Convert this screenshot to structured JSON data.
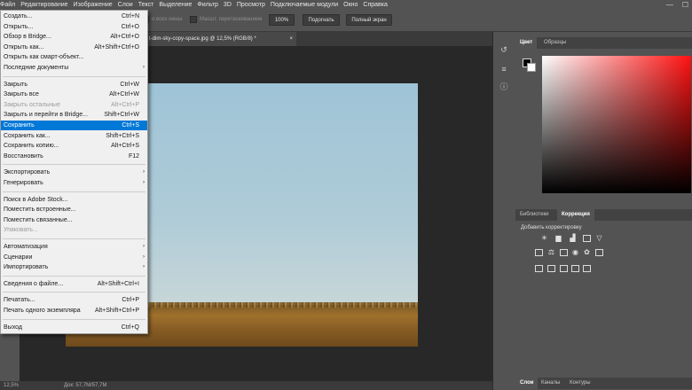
{
  "menubar": {
    "items": [
      "Файл",
      "Редактирование",
      "Изображение",
      "Слои",
      "Текст",
      "Выделение",
      "Фильтр",
      "3D",
      "Просмотр",
      "Подключаемые модули",
      "Окно",
      "Справка"
    ],
    "window_controls": [
      "—",
      "☐"
    ]
  },
  "options_bar": {
    "all_windows_label": "о всех окнах",
    "scrubby_label": "Масшт. перетаскиванием",
    "zoom_btn": "100%",
    "fit_btn": "Подогнать",
    "fullscreen_btn": "Полный экран"
  },
  "document": {
    "tab_title": "t-dim-sky-copy-space.jpg @ 12,5% (RGB/8) *",
    "close": "×"
  },
  "status": {
    "zoom": "12,5%",
    "doc": "Док: 57,7M/57,7M"
  },
  "file_menu": {
    "items": [
      {
        "label": "Создать...",
        "shortcut": "Ctrl+N",
        "state": "normal"
      },
      {
        "label": "Открыть...",
        "shortcut": "Ctrl+O",
        "state": "normal"
      },
      {
        "label": "Обзор в Bridge...",
        "shortcut": "Alt+Ctrl+O",
        "state": "normal"
      },
      {
        "label": "Открыть как...",
        "shortcut": "Alt+Shift+Ctrl+O",
        "state": "normal"
      },
      {
        "label": "Открыть как смарт-объект...",
        "shortcut": "",
        "state": "normal"
      },
      {
        "label": "Последние документы",
        "shortcut": "",
        "state": "submenu"
      },
      {
        "sep": true
      },
      {
        "label": "Закрыть",
        "shortcut": "Ctrl+W",
        "state": "normal"
      },
      {
        "label": "Закрыть все",
        "shortcut": "Alt+Ctrl+W",
        "state": "normal"
      },
      {
        "label": "Закрыть остальные",
        "shortcut": "Alt+Ctrl+P",
        "state": "disabled"
      },
      {
        "label": "Закрыть и перейти в Bridge...",
        "shortcut": "Shift+Ctrl+W",
        "state": "normal"
      },
      {
        "label": "Сохранить",
        "shortcut": "Ctrl+S",
        "state": "selected"
      },
      {
        "label": "Сохранить как...",
        "shortcut": "Shift+Ctrl+S",
        "state": "normal"
      },
      {
        "label": "Сохранить копию...",
        "shortcut": "Alt+Ctrl+S",
        "state": "normal"
      },
      {
        "label": "Восстановить",
        "shortcut": "F12",
        "state": "normal"
      },
      {
        "sep": true
      },
      {
        "label": "Экспортировать",
        "shortcut": "",
        "state": "submenu"
      },
      {
        "label": "Генерировать",
        "shortcut": "",
        "state": "submenu"
      },
      {
        "sep": true
      },
      {
        "label": "Поиск в Adobe Stock...",
        "shortcut": "",
        "state": "normal"
      },
      {
        "label": "Поместить встроенные...",
        "shortcut": "",
        "state": "normal"
      },
      {
        "label": "Поместить связанные...",
        "shortcut": "",
        "state": "normal"
      },
      {
        "label": "Упаковать...",
        "shortcut": "",
        "state": "disabled"
      },
      {
        "sep": true
      },
      {
        "label": "Автоматизация",
        "shortcut": "",
        "state": "submenu"
      },
      {
        "label": "Сценарии",
        "shortcut": "",
        "state": "submenu"
      },
      {
        "label": "Импортировать",
        "shortcut": "",
        "state": "submenu"
      },
      {
        "sep": true
      },
      {
        "label": "Сведения о файле...",
        "shortcut": "Alt+Shift+Ctrl+I",
        "state": "normal"
      },
      {
        "sep": true
      },
      {
        "label": "Печатать...",
        "shortcut": "Ctrl+P",
        "state": "normal"
      },
      {
        "label": "Печать одного экземпляра",
        "shortcut": "Alt+Shift+Ctrl+P",
        "state": "normal"
      },
      {
        "sep": true
      },
      {
        "label": "Выход",
        "shortcut": "Ctrl+Q",
        "state": "normal"
      }
    ],
    "submenu_arrow": "›"
  },
  "color_panel": {
    "tabs": [
      "Цвет",
      "Образцы"
    ],
    "active_tab": "Цвет",
    "hue": "#ff1111"
  },
  "adjust_panel": {
    "tabs": [
      "Библиотеки",
      "Коррекция"
    ],
    "active_tab": "Коррекция",
    "title": "Добавить корректировку"
  },
  "layers_panel": {
    "tabs": [
      "Слои",
      "Каналы",
      "Контуры"
    ],
    "active_tab": "Слои"
  },
  "accent_color": "#0078d7"
}
